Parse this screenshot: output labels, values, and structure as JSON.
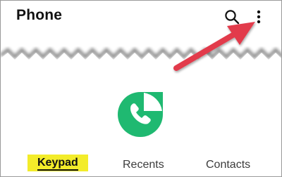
{
  "header": {
    "title": "Phone",
    "search_icon": "search-icon",
    "more_icon": "more-vert-icon"
  },
  "annotation": {
    "arrow_color": "#e23b4c",
    "points_to": "more-options-button"
  },
  "app_logo": {
    "icon": "phone-handset-icon",
    "color": "#1fb971"
  },
  "tabs": [
    {
      "label": "Keypad",
      "active": true,
      "highlight_color": "#f3ec2a"
    },
    {
      "label": "Recents",
      "active": false
    },
    {
      "label": "Contacts",
      "active": false
    }
  ]
}
